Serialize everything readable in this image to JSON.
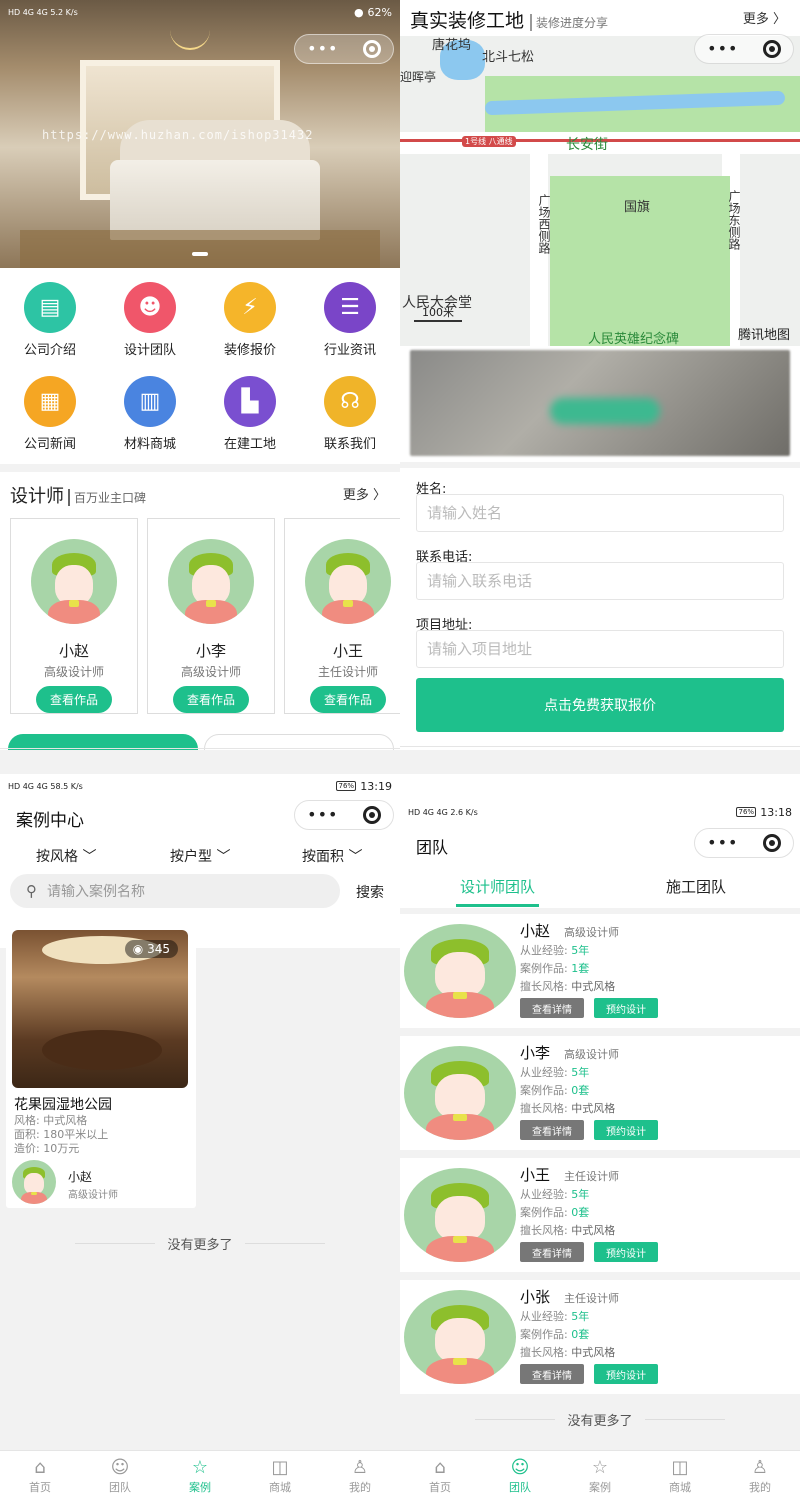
{
  "colors": {
    "accent": "#1ec08c",
    "gray_button": "#777777"
  },
  "p1": {
    "status": {
      "left": "HD 4G 4G 5.2 K/s",
      "right": "62%"
    },
    "watermark": "https://www.huzhan.com/ishop31432",
    "menu": [
      {
        "label": "公司介绍",
        "icon": "document-icon",
        "color": "#2dc4a4",
        "glyph": "▤"
      },
      {
        "label": "设计团队",
        "icon": "team-icon",
        "color": "#f0566a",
        "glyph": "☻"
      },
      {
        "label": "装修报价",
        "icon": "price-tag-icon",
        "color": "#f5b52a",
        "glyph": "⚡"
      },
      {
        "label": "行业资讯",
        "icon": "chat-icon",
        "color": "#7a45c8",
        "glyph": "☰"
      },
      {
        "label": "公司新闻",
        "icon": "notepad-icon",
        "color": "#f5a623",
        "glyph": "▦"
      },
      {
        "label": "材料商城",
        "icon": "shop-icon",
        "color": "#4a84e0",
        "glyph": "▥"
      },
      {
        "label": "在建工地",
        "icon": "building-icon",
        "color": "#7a4fd0",
        "glyph": "▙"
      },
      {
        "label": "联系我们",
        "icon": "headset-icon",
        "color": "#f0b429",
        "glyph": "☊"
      }
    ],
    "section": {
      "title": "设计师",
      "subtitle": "百万业主口碑",
      "more": "更多 〉"
    },
    "designers": [
      {
        "name": "小赵",
        "title": "高级设计师",
        "button": "查看作品"
      },
      {
        "name": "小李",
        "title": "高级设计师",
        "button": "查看作品"
      },
      {
        "name": "小王",
        "title": "主任设计师",
        "button": "查看作品"
      }
    ]
  },
  "p2": {
    "title": "真实装修工地",
    "subtitle": "装修进度分享",
    "more": "更多 〉",
    "map": {
      "labels": [
        "唐花坞",
        "北斗七松",
        "迎晖亭",
        "长安街",
        "国旗",
        "人民大会堂",
        "人民英雄纪念碑",
        "1号线 八通线"
      ],
      "vlabels": [
        "广场西侧路",
        "广场东侧路"
      ],
      "scale": "100米",
      "logo": "腾讯地图"
    },
    "form": {
      "name_label": "姓名:",
      "name_placeholder": "请输入姓名",
      "phone_label": "联系电话:",
      "phone_placeholder": "请输入联系电话",
      "addr_label": "项目地址:",
      "addr_placeholder": "请输入项目地址",
      "submit": "点击免费获取报价"
    }
  },
  "tabs": [
    {
      "label": "首页",
      "icon": "home-icon",
      "glyph": "⌂"
    },
    {
      "label": "团队",
      "icon": "team-icon",
      "glyph": "☺"
    },
    {
      "label": "案例",
      "icon": "case-star-icon",
      "glyph": "☆"
    },
    {
      "label": "商城",
      "icon": "shopping-bag-icon",
      "glyph": "◫"
    },
    {
      "label": "我的",
      "icon": "user-icon",
      "glyph": "♙"
    }
  ],
  "p3": {
    "status": {
      "left": "HD 4G 4G 58.5 K/s",
      "right": "76%",
      "time": "13:19"
    },
    "title": "案例中心",
    "filters": [
      "按风格",
      "按户型",
      "按面积"
    ],
    "search_placeholder": "请输入案例名称",
    "search_button": "搜索",
    "case": {
      "views": "345",
      "name": "花果园湿地公园",
      "style": "风格:   中式风格",
      "area": "面积:   180平米以上",
      "price": "造价:   10万元",
      "author": "小赵",
      "author_title": "高级设计师"
    },
    "nomore": "没有更多了"
  },
  "p4": {
    "status": {
      "left": "HD 4G 4G 2.6 K/s",
      "right": "76%",
      "time": "13:18"
    },
    "title": "团队",
    "tabs": [
      "设计师团队",
      "施工团队"
    ],
    "exp_label": "从业经验:",
    "works_label": "案例作品:",
    "style_label": "擅长风格:",
    "detail_button": "查看详情",
    "book_button": "预约设计",
    "members": [
      {
        "name": "小赵",
        "title": "高级设计师",
        "exp": "5年",
        "works": "1套",
        "style": "中式风格"
      },
      {
        "name": "小李",
        "title": "高级设计师",
        "exp": "5年",
        "works": "0套",
        "style": "中式风格"
      },
      {
        "name": "小王",
        "title": "主任设计师",
        "exp": "5年",
        "works": "0套",
        "style": "中式风格"
      },
      {
        "name": "小张",
        "title": "主任设计师",
        "exp": "5年",
        "works": "0套",
        "style": "中式风格"
      }
    ],
    "nomore": "没有更多了"
  }
}
